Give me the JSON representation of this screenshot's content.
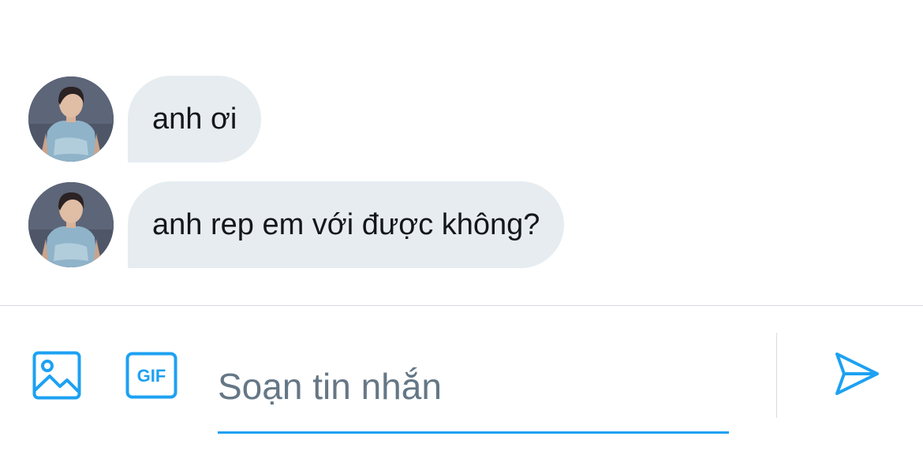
{
  "conversation": {
    "messages": [
      {
        "text": "anh ơi",
        "sender": "other"
      },
      {
        "text": "anh rep em với được không?",
        "sender": "other"
      }
    ]
  },
  "composer": {
    "placeholder": "Soạn tin nhắn",
    "value": "",
    "gif_label": "GIF"
  },
  "icons": {
    "media": "image-icon",
    "gif": "gif-icon",
    "send": "send-icon"
  },
  "colors": {
    "accent": "#1da1f2",
    "bubble_bg": "#e6ecf0",
    "text": "#14171a",
    "placeholder": "#657786",
    "divider": "#d7dde2"
  }
}
